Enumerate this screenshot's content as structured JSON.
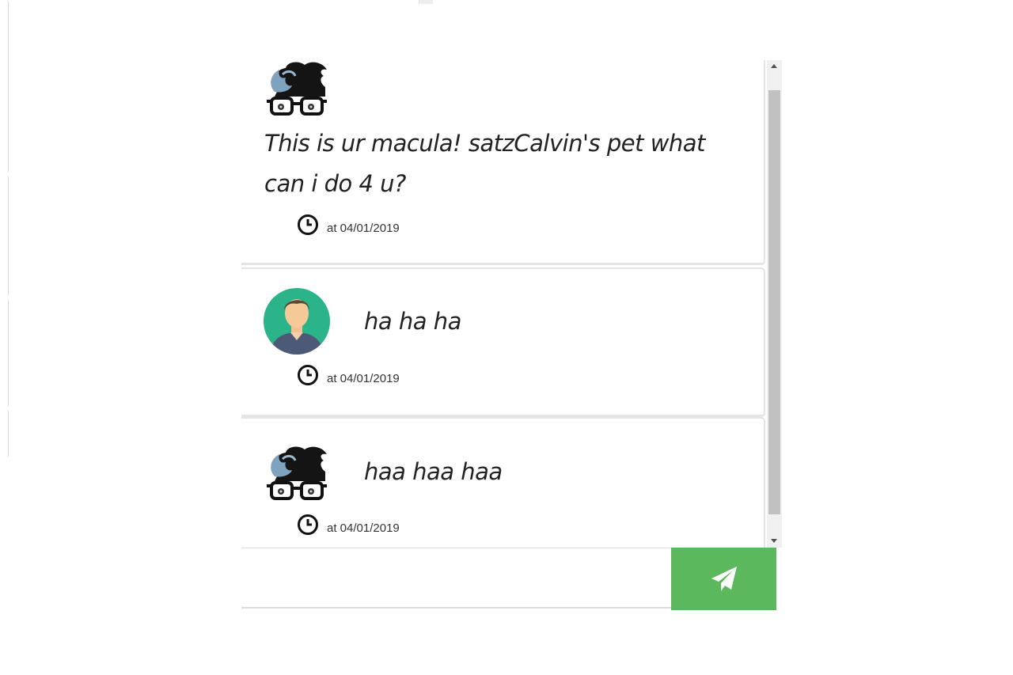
{
  "messages": [
    {
      "sender": "bot",
      "avatar_icon": "nerd-glasses-avatar-icon",
      "text": "This is ur macula! satzCalvin's pet what can i do 4 u?",
      "meta": "at 04/01/2019"
    },
    {
      "sender": "user",
      "avatar_icon": "user-avatar-icon",
      "text": "ha ha ha",
      "meta": "at 04/01/2019"
    },
    {
      "sender": "bot",
      "avatar_icon": "nerd-glasses-avatar-icon",
      "text": "haa haa haa",
      "meta": "at 04/01/2019"
    }
  ],
  "composer": {
    "placeholder": "",
    "value": "",
    "send_icon": "paper-plane-icon",
    "send_color": "#5cb85c"
  }
}
